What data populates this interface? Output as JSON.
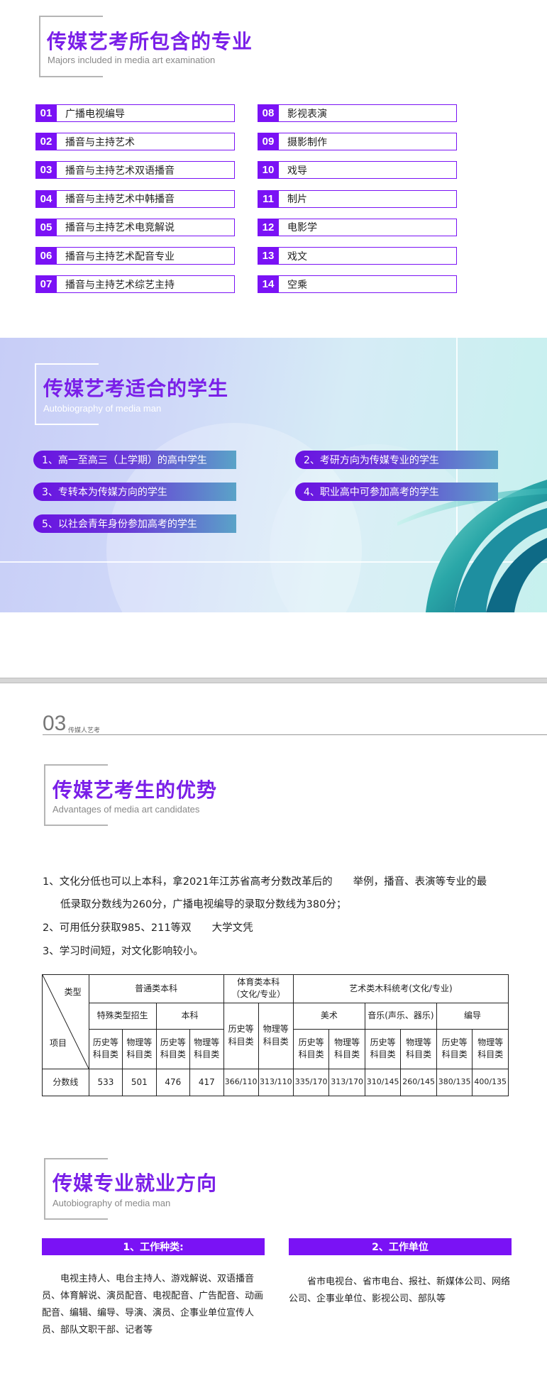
{
  "section1": {
    "title": "传媒艺考所包含的专业",
    "subtitle": "Majors included in media art examination",
    "majors": [
      {
        "num": "01",
        "name": "广播电视编导"
      },
      {
        "num": "02",
        "name": "播音与主持艺术"
      },
      {
        "num": "03",
        "name": "播音与主持艺术双语播音"
      },
      {
        "num": "04",
        "name": "播音与主持艺术中韩播音"
      },
      {
        "num": "05",
        "name": "播音与主持艺术电竞解说"
      },
      {
        "num": "06",
        "name": "播音与主持艺术配音专业"
      },
      {
        "num": "07",
        "name": "播音与主持艺术综艺主持"
      },
      {
        "num": "08",
        "name": "影视表演"
      },
      {
        "num": "09",
        "name": "摄影制作"
      },
      {
        "num": "10",
        "name": "戏导"
      },
      {
        "num": "11",
        "name": "制片"
      },
      {
        "num": "12",
        "name": "电影学"
      },
      {
        "num": "13",
        "name": "戏文"
      },
      {
        "num": "14",
        "name": "空乘"
      }
    ]
  },
  "section2": {
    "title": "传媒艺考适合的学生",
    "subtitle": "Autobiography of media man",
    "items": [
      "1、高一至高三（上学期）的高中学生",
      "2、考研方向为传媒专业的学生",
      "3、专转本为传媒方向的学生",
      "4、职业高中可参加高考的学生",
      "5、以社会青年身份参加高考的学生"
    ]
  },
  "page": {
    "number": "03",
    "label": "传媒人艺考"
  },
  "section3": {
    "title": "传媒艺考生的优势",
    "subtitle": "Advantages of media art candidates",
    "points": [
      "1、文化分低也可以上本科，拿2021年江苏省高考分数改革后的　　举例，播音、表演等专业的最",
      "低录取分数线为260分，广播电视编导的录取分数线为380分；",
      "2、可用低分获取985、211等双　　大学文凭",
      "3、学习时间短，对文化影响较小。"
    ],
    "table": {
      "corner_top": "类型",
      "corner_bottom": "项目",
      "groups": {
        "regular": "普通类本科",
        "sports": "体育类本科（文化/专业）",
        "art": "艺术类木科统考(文化/专业)"
      },
      "subgroups": {
        "special": "特殊类型招生",
        "bachelor": "本科",
        "fine_art": "美术",
        "music": "音乐(声乐、器乐)",
        "director": "编导"
      },
      "col_history": "历史等科目类",
      "col_physics": "物理等科目类",
      "row_label": "分数线",
      "values": [
        "533",
        "501",
        "476",
        "417",
        "366/110",
        "313/110",
        "335/170",
        "313/170",
        "310/145",
        "260/145",
        "380/135",
        "400/135"
      ]
    }
  },
  "section4": {
    "title": "传媒专业就业方向",
    "subtitle": "Autobiography of media man",
    "job_types_title": "1、工作种类:",
    "job_types_text": "电视主持人、电台主持人、游戏解说、双语播音员、体育解说、演员配音、电视配音、广告配音、动画配音、编辑、编导、导演、演员、企事业单位宣传人员、部队文职干部、记者等",
    "job_units_title": "2、工作单位",
    "job_units_text": "省市电视台、省市电台、报社、新媒体公司、网络公司、企事业单位、影视公司、部队等"
  },
  "colors": {
    "accent": "#7a12f5",
    "title": "#7a1fe8"
  }
}
